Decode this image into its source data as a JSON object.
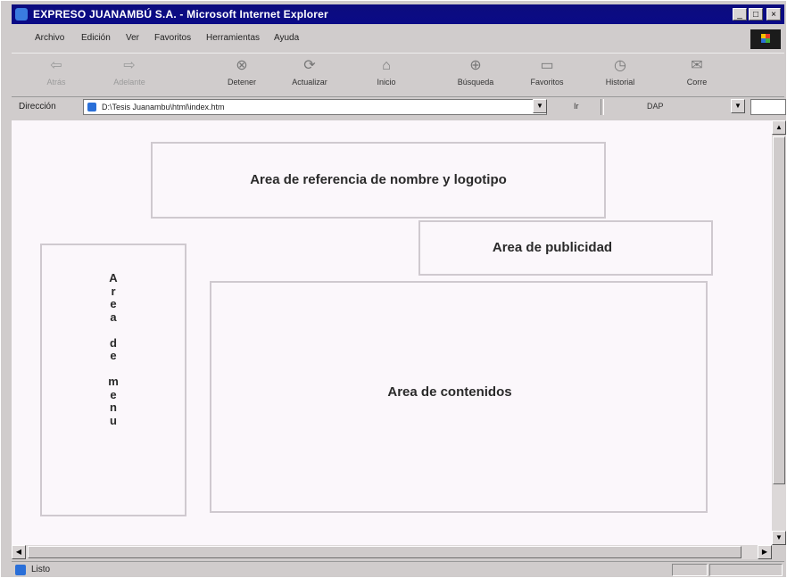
{
  "window": {
    "title": "EXPRESO JUANAMBÚ S.A. - Microsoft Internet Explorer"
  },
  "menu": {
    "items": [
      "Archivo",
      "Edición",
      "Ver",
      "Favoritos",
      "Herramientas",
      "Ayuda"
    ]
  },
  "toolbar": {
    "buttons": [
      {
        "label": "Atrás",
        "icon": "back-arrow-icon",
        "glyph": "⇦"
      },
      {
        "label": "Adelante",
        "icon": "forward-arrow-icon",
        "glyph": "⇨"
      },
      {
        "label": "Detener",
        "icon": "stop-icon",
        "glyph": "⊗"
      },
      {
        "label": "Actualizar",
        "icon": "refresh-icon",
        "glyph": "⟳"
      },
      {
        "label": "Inicio",
        "icon": "home-icon",
        "glyph": "⌂"
      },
      {
        "label": "Búsqueda",
        "icon": "search-icon",
        "glyph": "⊕"
      },
      {
        "label": "Favoritos",
        "icon": "favorites-icon",
        "glyph": "▭"
      },
      {
        "label": "Historial",
        "icon": "history-icon",
        "glyph": "◷"
      },
      {
        "label": "Corre",
        "icon": "mail-icon",
        "glyph": "✉"
      }
    ]
  },
  "address": {
    "label": "Dirección",
    "url": "D:\\Tesis Juanambu\\html\\index.htm",
    "go_label": "Ir",
    "dap_label": "DAP"
  },
  "page": {
    "logo_area": "Area de referencia de nombre y logotipo",
    "ads_area": "Area de publicidad",
    "menu_area": "A\nr\ne\na\n\nd\ne\n\nm\ne\nn\nu",
    "content_area": "Area de contenidos"
  },
  "status": {
    "text": "Listo"
  }
}
